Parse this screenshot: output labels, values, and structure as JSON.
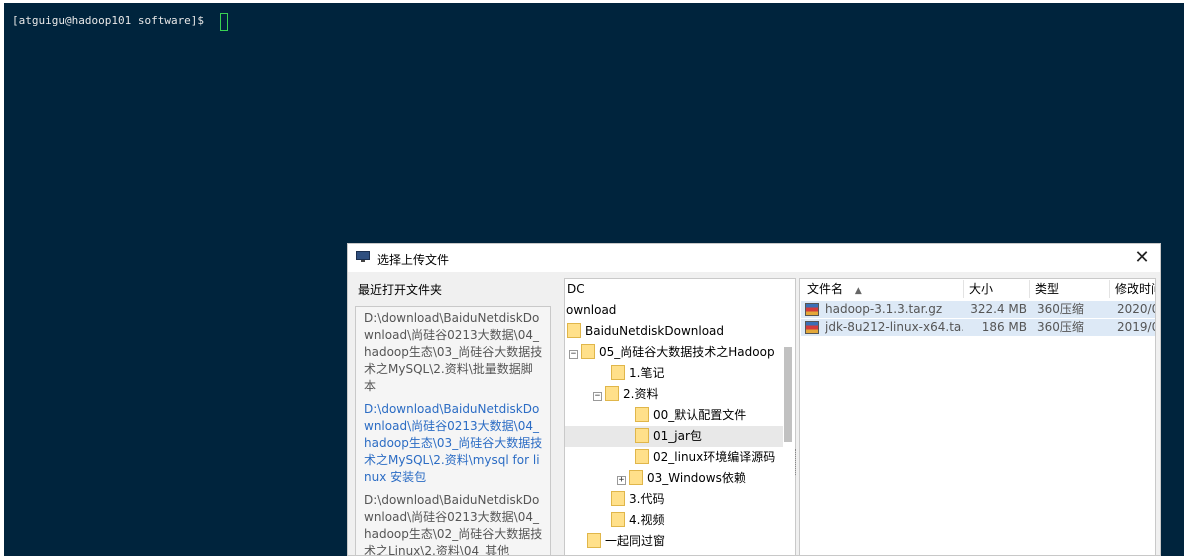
{
  "terminal": {
    "prompt": "[atguigu@hadoop101 software]$ "
  },
  "dialog": {
    "title": "选择上传文件",
    "close_glyph": "✕",
    "recent_label": "最近打开文件夹",
    "recent": [
      "D:\\download\\BaiduNetdiskDownload\\尚硅谷0213大数据\\04_hadoop生态\\03_尚硅谷大数据技术之MySQL\\2.资料\\批量数据脚本",
      "D:\\download\\BaiduNetdiskDownload\\尚硅谷0213大数据\\04_hadoop生态\\03_尚硅谷大数据技术之MySQL\\2.资料\\mysql for linux 安装包",
      "D:\\download\\BaiduNetdiskDownload\\尚硅谷0213大数据\\04_hadoop生态\\02_尚硅谷大数据技术之Linux\\2.资料\\04_其他"
    ],
    "tree": [
      {
        "label": "DC",
        "expander": "",
        "folder": false
      },
      {
        "label": "ownload",
        "expander": "",
        "folder": false
      },
      {
        "label": "BaiduNetdiskDownload",
        "expander": "",
        "folder": true
      },
      {
        "label": "05_尚硅谷大数据技术之Hadoop",
        "expander": "−",
        "folder": true
      },
      {
        "label": "1.笔记",
        "expander": "",
        "folder": true
      },
      {
        "label": "2.资料",
        "expander": "−",
        "folder": true
      },
      {
        "label": "00_默认配置文件",
        "expander": "",
        "folder": true
      },
      {
        "label": "01_jar包",
        "expander": "",
        "folder": true,
        "selected": true
      },
      {
        "label": "02_linux环境编译源码",
        "expander": "",
        "folder": true
      },
      {
        "label": "03_Windows依赖",
        "expander": "+",
        "folder": true
      },
      {
        "label": "3.代码",
        "expander": "",
        "folder": true
      },
      {
        "label": "4.视频",
        "expander": "",
        "folder": true
      },
      {
        "label": "一起同过窗",
        "expander": "",
        "folder": true
      }
    ],
    "columns": [
      "文件名",
      "大小",
      "类型",
      "修改时间"
    ],
    "sort_glyph": "▲",
    "files": [
      {
        "name": "hadoop-3.1.3.tar.gz",
        "size": "322.4 MB",
        "type": "360压缩",
        "modified": "2020/0"
      },
      {
        "name": "jdk-8u212-linux-x64.ta...",
        "size": "186 MB",
        "type": "360压缩",
        "modified": "2019/0"
      }
    ]
  }
}
